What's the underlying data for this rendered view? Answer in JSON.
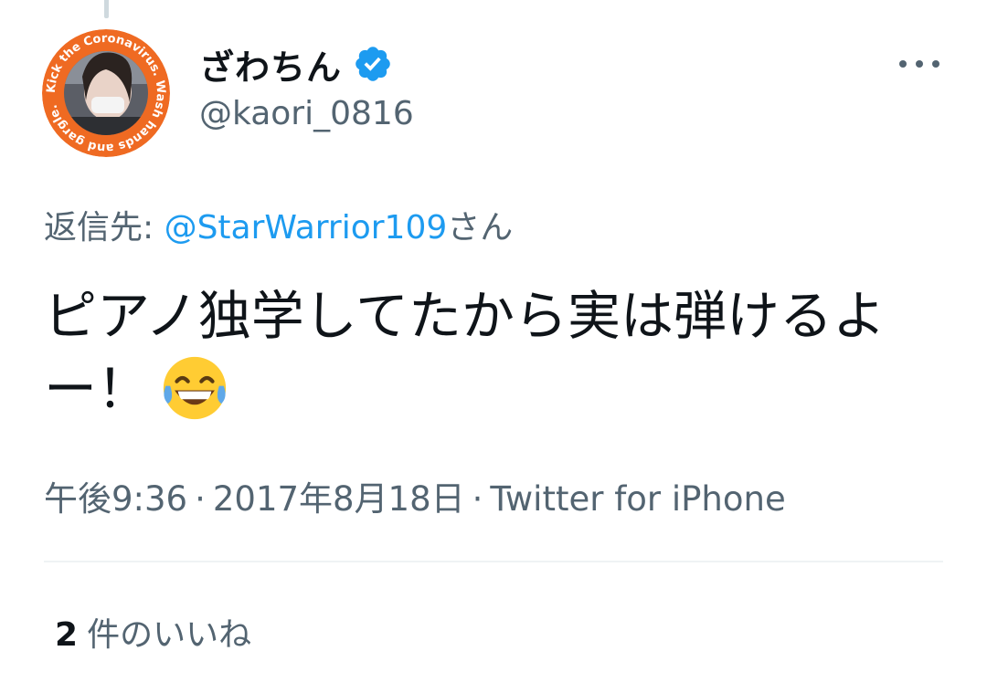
{
  "tweet": {
    "author": {
      "display_name": "ざわちん",
      "handle": "@kaori_0816",
      "verified": true,
      "avatar_ring_text": "Kick the Coronavirus. Wash hands and gargle."
    },
    "reply_to": {
      "prefix": "返信先: ",
      "mention": "@StarWarrior109",
      "suffix": "さん"
    },
    "text": "ピアノ独学してたから実は弾けるよー！",
    "emoji": "face-with-tears-of-joy",
    "timestamp": "午後9:36",
    "date": "2017年8月18日",
    "separator": "·",
    "source": "Twitter for iPhone",
    "likes": {
      "count": "2",
      "label": "件のいいね"
    }
  },
  "colors": {
    "text_primary": "#0f1419",
    "text_secondary": "#536471",
    "link": "#1d9bf0",
    "divider": "#eff3f4",
    "avatar_ring": "#ef6a22",
    "verified": "#1d9bf0"
  },
  "icons": {
    "more": "more-horizontal-icon",
    "verified": "verified-badge-icon"
  }
}
